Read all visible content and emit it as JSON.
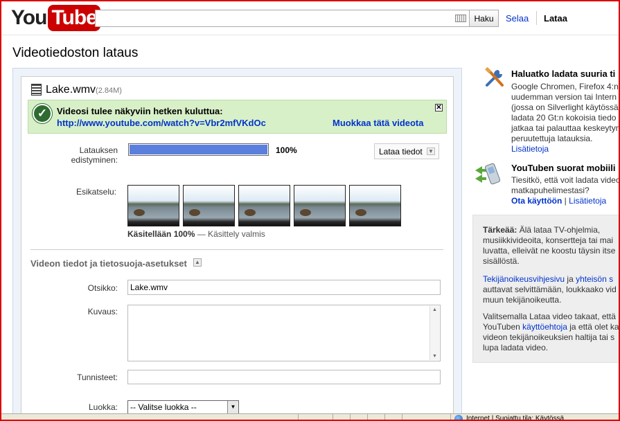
{
  "header": {
    "logo_you": "You",
    "logo_tube": "Tube",
    "search_value": "",
    "search_button": "Haku",
    "nav_browse": "Selaa",
    "nav_upload": "Lataa"
  },
  "page_title": "Videotiedoston lataus",
  "upload": {
    "file_name": "Lake.wmv",
    "file_size": "(2.84M)",
    "notice_title": "Videosi tulee näkyviin hetken kuluttua:",
    "notice_link": "http://www.youtube.com/watch?v=Vbr2mfVKdOc",
    "edit_link": "Muokkaa tätä videota",
    "close_glyph": "✕",
    "progress_label_1": "Latauksen",
    "progress_label_2": "edistyminen:",
    "progress_value": 1.0,
    "progress_text": "100%",
    "info_button": "Lataa tiedot",
    "preview_label": "Esikatselu:",
    "processing_bold": "Käsitellään 100%",
    "processing_rest": " — Käsittely valmis"
  },
  "details": {
    "section_title": "Videon tiedot ja tietosuoja-asetukset",
    "title_label": "Otsikko:",
    "title_value": "Lake.wmv",
    "description_label": "Kuvaus:",
    "description_value": "",
    "tags_label": "Tunnisteet:",
    "tags_value": "",
    "category_label": "Luokka:",
    "category_value": "-- Valitse luokka --"
  },
  "sidebar": {
    "tip1_title": "Haluatko ladata suuria ti",
    "tip1_lines": [
      "Google Chromen, Firefox 4:n",
      "uudemman version tai Intern",
      "(jossa on Silverlight käytössä",
      "ladata 20 Gt:n kokoisia tiedo",
      "jatkaa tai palauttaa keskeytyn",
      "peruutettuja latauksia."
    ],
    "tip1_link": "Lisätietoja",
    "tip2_title": "YouTuben suorat mobiili",
    "tip2_lines": [
      "Tiesitkö, että voit ladata video",
      "matkapuhelimestasi?"
    ],
    "tip2_link1": "Ota käyttöön",
    "tip2_sep": " | ",
    "tip2_link2": "Lisätietoja",
    "important_bold": "Tärkeää:",
    "important_lines": [
      " Älä lataa TV-ohjelmia,",
      "musiikkivideoita, konsertteja tai mai",
      "luvatta, elleivät ne koostu täysin itse",
      "sisällöstä."
    ],
    "copyright_link1": "Tekijänoikeusvihjesivu",
    "copyright_mid": " ja ",
    "copyright_link2": "yhteisön s",
    "copyright_lines": [
      "auttavat selvittämään, loukkaako vid",
      "muun tekijänoikeutta."
    ],
    "terms_line1": "Valitsemalla Lataa video takaat, että",
    "terms_pre": "YouTuben ",
    "terms_link": "käyttöehtoja",
    "terms_post": " ja että olet ka",
    "terms_lines": [
      "videon tekijänoikeuksien haltija tai s",
      "lupa ladata video."
    ]
  },
  "statusbar": {
    "text": "Internet | Suojattu tila: Käytössä"
  }
}
